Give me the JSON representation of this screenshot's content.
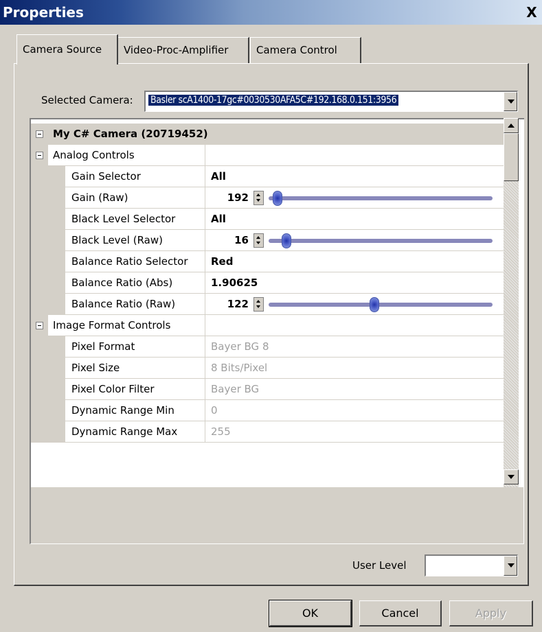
{
  "window": {
    "title": "Properties",
    "close_label": "X"
  },
  "tabs": [
    {
      "label": "Camera Source",
      "active": true
    },
    {
      "label": "Video-Proc-Amplifier",
      "active": false
    },
    {
      "label": "Camera Control",
      "active": false
    }
  ],
  "camera_select": {
    "label": "Selected Camera:",
    "value": "Basler scA1400-17gc#0030530AFA5C#192.168.0.151:3956"
  },
  "grid": {
    "root": "My C# Camera (20719452)",
    "group_analog": "Analog Controls",
    "analog": {
      "gain_selector": {
        "name": "Gain Selector",
        "value": "All"
      },
      "gain_raw": {
        "name": "Gain (Raw)",
        "value": "192",
        "slider": 0.02
      },
      "black_level_selector": {
        "name": "Black Level Selector",
        "value": "All"
      },
      "black_level_raw": {
        "name": "Black Level (Raw)",
        "value": "16",
        "slider": 0.06
      },
      "balance_ratio_selector": {
        "name": "Balance Ratio Selector",
        "value": "Red"
      },
      "balance_ratio_abs": {
        "name": "Balance Ratio (Abs)",
        "value": "1.90625"
      },
      "balance_ratio_raw": {
        "name": "Balance Ratio (Raw)",
        "value": "122",
        "slider": 0.47
      }
    },
    "group_image": "Image Format Controls",
    "image": {
      "pixel_format": {
        "name": "Pixel Format",
        "value": "Bayer BG 8"
      },
      "pixel_size": {
        "name": "Pixel Size",
        "value": "8 Bits/Pixel"
      },
      "pixel_color_filter": {
        "name": "Pixel Color Filter",
        "value": "Bayer BG"
      },
      "dynamic_range_min": {
        "name": "Dynamic Range Min",
        "value": "0"
      },
      "dynamic_range_max": {
        "name": "Dynamic Range Max",
        "value": "255"
      }
    }
  },
  "user_level": {
    "label": "User Level",
    "value": ""
  },
  "buttons": {
    "ok": "OK",
    "cancel": "Cancel",
    "apply": "Apply"
  }
}
